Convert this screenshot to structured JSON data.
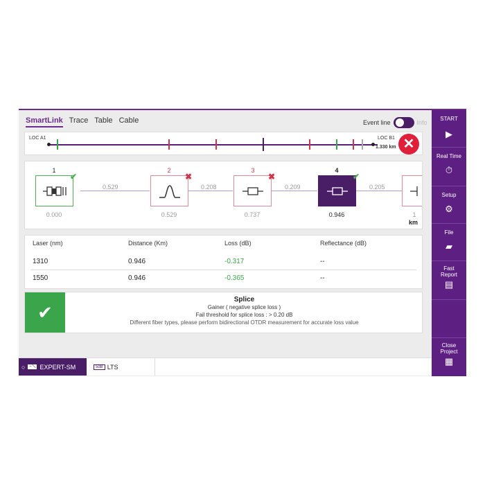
{
  "tabs": [
    "SmartLink",
    "Trace",
    "Table",
    "Cable"
  ],
  "event_line": {
    "label": "Event line",
    "off_label": "Info"
  },
  "overview": {
    "start_label": "LOC A1",
    "end_label": "LOC B1",
    "end_distance": "1.330 km",
    "status": "fail"
  },
  "events": [
    {
      "num": "1",
      "distance": "0.000",
      "result": "pass",
      "type": "launch-connector"
    },
    {
      "num": "2",
      "distance": "0.529",
      "result": "fail",
      "type": "reflective-peak"
    },
    {
      "num": "3",
      "distance": "0.737",
      "result": "fail",
      "type": "splice"
    },
    {
      "num": "4",
      "distance": "0.946",
      "result": "pass",
      "type": "splice",
      "selected": true
    },
    {
      "num": "",
      "distance": "1",
      "type": "end-connector"
    }
  ],
  "segments": [
    "0.529",
    "0.208",
    "0.209",
    "0.205"
  ],
  "unit": "km",
  "results": {
    "headers": [
      "Laser (nm)",
      "Distance (Km)",
      "Loss (dB)",
      "Reflectance (dB)"
    ],
    "rows": [
      [
        "1310",
        "0.946",
        "-0.317",
        "--"
      ],
      [
        "1550",
        "0.946",
        "-0.365",
        "--"
      ]
    ]
  },
  "verdict": {
    "title": "Splice",
    "line1": "Gainer ( negative splice loss )",
    "line2": "Fail threshold for splice loss : > 0.20 dB",
    "line3": "Different fiber types, please perform bidirectional OTDR measurement for accurate loss value",
    "status": "pass"
  },
  "statusbar": {
    "tab1": "EXPERT-SM",
    "tab2": "LTS",
    "tab2_icon": "5dB"
  },
  "sidebar": [
    {
      "label": "START",
      "icon": "play-icon"
    },
    {
      "label": "Real Time",
      "icon": "stopwatch-icon"
    },
    {
      "label": "Setup",
      "icon": "gear-icon"
    },
    {
      "label": "File",
      "icon": "folder-icon"
    },
    {
      "label": "Fast Report",
      "icon": "report-icon"
    },
    {
      "label": "Close Project",
      "icon": "grid-icon"
    }
  ],
  "colors": {
    "accent": "#5d1f82",
    "pass": "#3aa54a",
    "fail": "#e0203a"
  }
}
